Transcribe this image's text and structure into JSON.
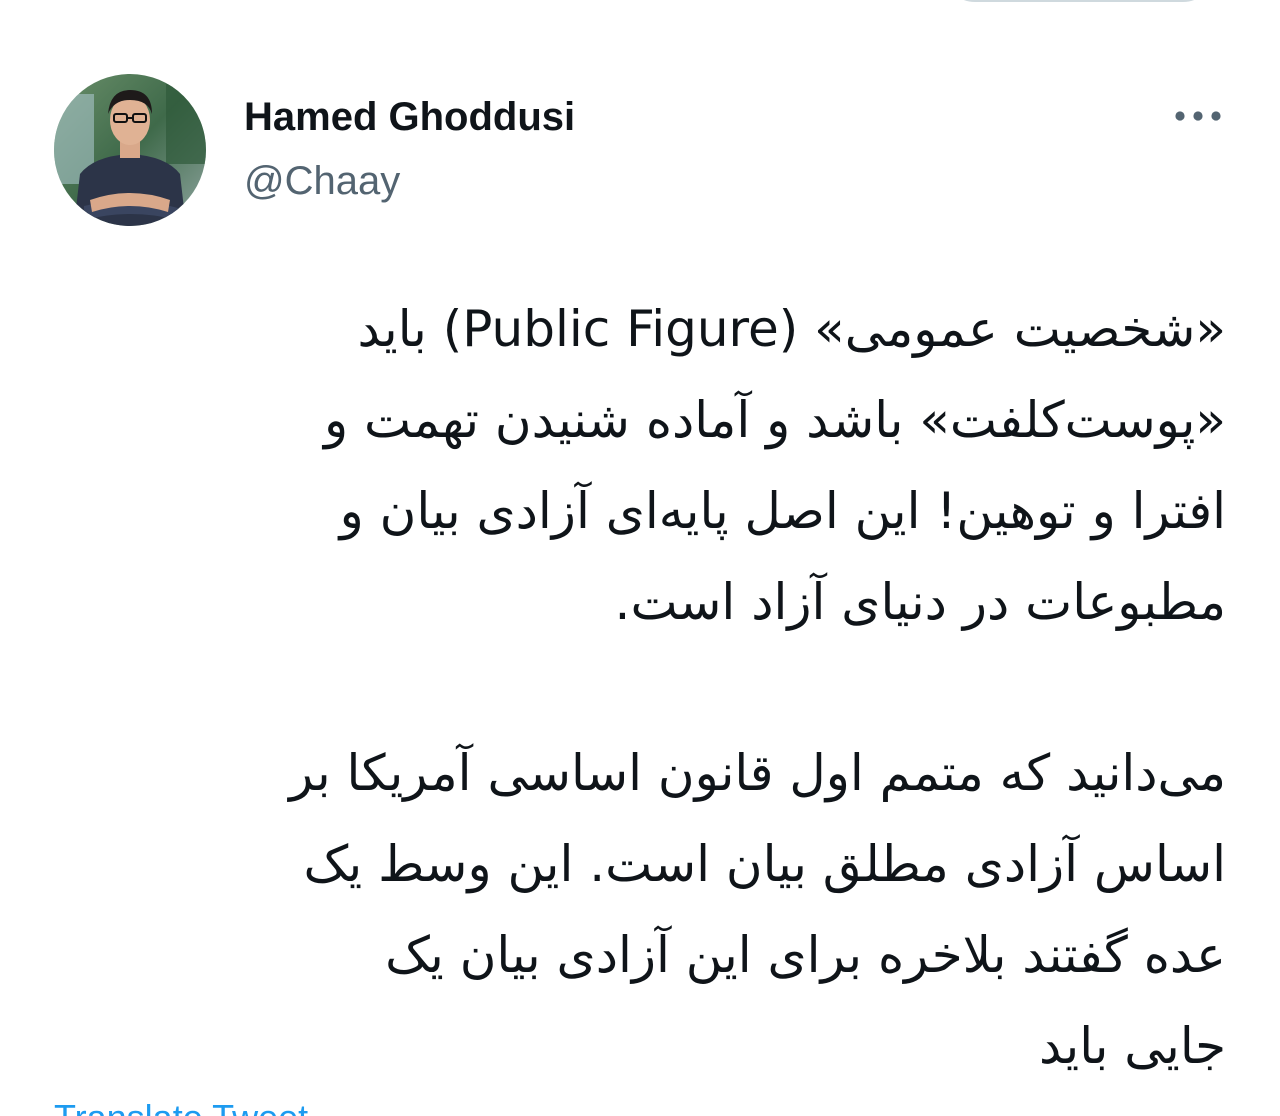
{
  "tweet": {
    "author": {
      "display_name": "Hamed Ghoddusi",
      "handle": "@Chaay",
      "avatar_icon": "profile-photo"
    },
    "more_icon": "more-options-icon",
    "paragraphs": [
      {
        "lines": [
          "«شخصیت عمومی» (Public Figure) باید",
          "«پوست‌کلفت» باشد و آماده شنیدن تهمت و",
          "افترا و توهین! این اصل پایه‌ای آزادی بیان و",
          "مطبوعات در دنیای آزاد است."
        ]
      },
      {
        "lines": [
          "می‌دانید که متمم اول قانون اساسی آمریکا بر",
          "اساس آزادی مطلق بیان است. این وسط یک",
          "عده گفتند بلاخره برای این آزادی بیان یک",
          "جایی باید"
        ]
      }
    ],
    "translate_label": "Translate Tweet"
  },
  "colors": {
    "text_primary": "#0f1419",
    "text_secondary": "#536471",
    "link": "#1d9bf0"
  }
}
